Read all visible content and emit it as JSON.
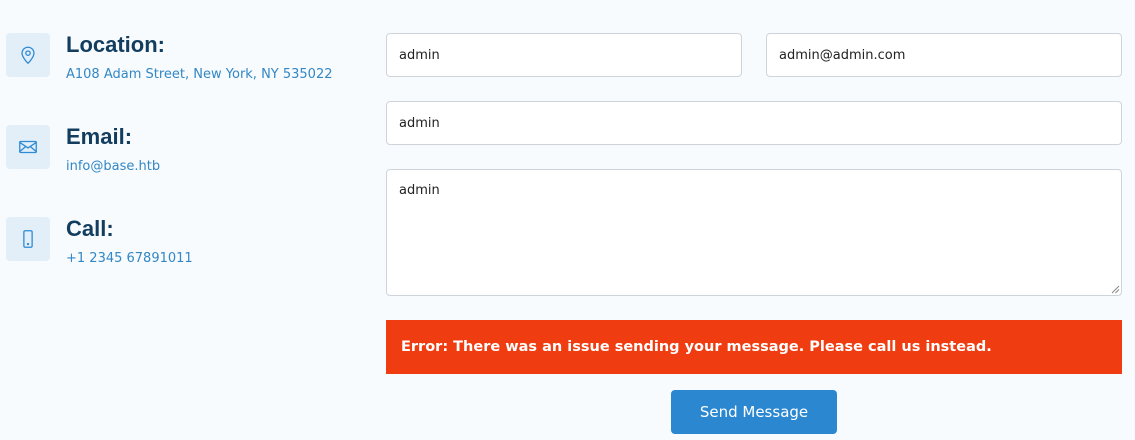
{
  "colors": {
    "background": "#f7fbfe",
    "icon_bg": "#e2eef8",
    "icon_stroke": "#2d8ad3",
    "heading": "#123d5e",
    "link_text": "#3387c4",
    "error_bg": "#ef3d11",
    "button_bg": "#2a87d0"
  },
  "contact_info": [
    {
      "icon": "map-pin-icon",
      "title": "Location:",
      "text": "A108 Adam Street, New York, NY 535022"
    },
    {
      "icon": "envelope-icon",
      "title": "Email:",
      "text": "info@base.htb"
    },
    {
      "icon": "phone-icon",
      "title": "Call:",
      "text": "+1 2345 67891011"
    }
  ],
  "form": {
    "name_value": "admin",
    "email_value": "admin@admin.com",
    "subject_value": "admin",
    "message_value": "admin",
    "error_message": "Error: There was an issue sending your message. Please call us instead.",
    "send_label": "Send Message"
  }
}
